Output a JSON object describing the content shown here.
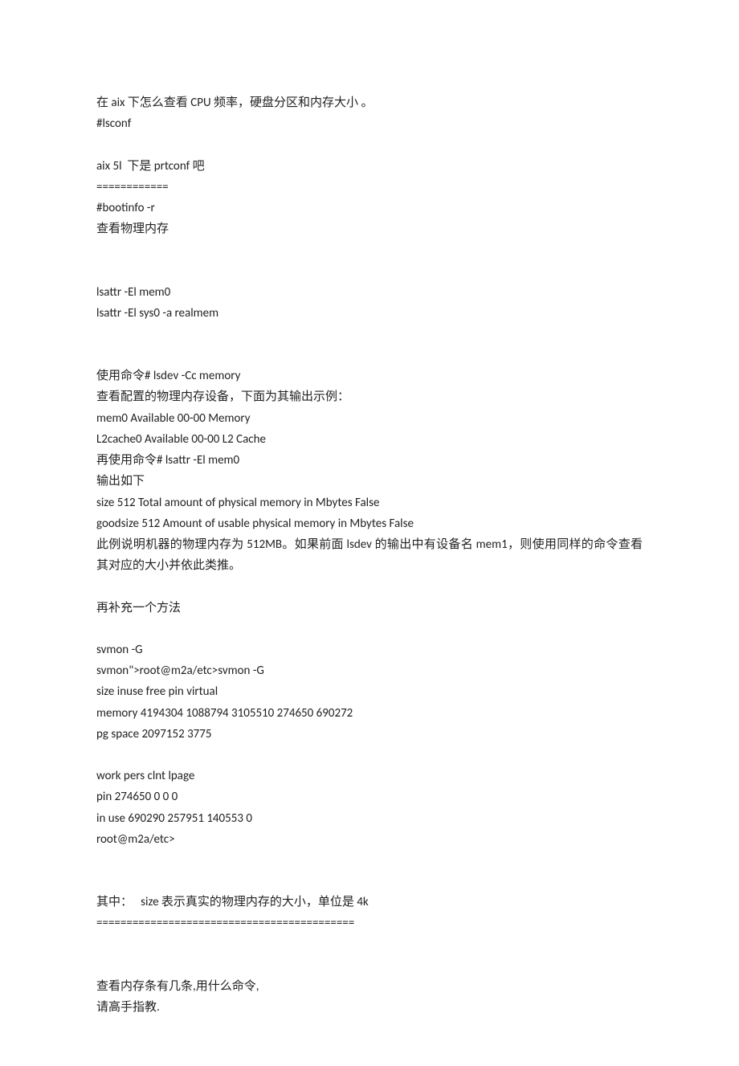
{
  "lines": [
    "在 aix 下怎么查看 CPU 频率，硬盘分区和内存大小 。",
    "#lsconf",
    "",
    "aix 5l  下是 prtconf 吧",
    "============",
    "#bootinfo -r",
    "查看物理内存",
    "",
    "",
    "lsattr -El mem0",
    "lsattr -El sys0 -a realmem",
    "",
    "",
    "使用命令# lsdev -Cc memory",
    "查看配置的物理内存设备，下面为其输出示例：",
    "mem0 Available 00-00 Memory",
    "L2cache0 Available 00-00 L2 Cache",
    "再使用命令# lsattr -El mem0",
    "输出如下",
    "size 512 Total amount of physical memory in Mbytes False",
    "goodsize 512 Amount of usable physical memory in Mbytes False",
    "此例说明机器的物理内存为 512MB。如果前面 lsdev 的输出中有设备名 mem1，则使用同样的命令查看其对应的大小并依此类推。",
    "",
    "再补充一个方法",
    "",
    "svmon -G",
    "svmon\">root@m2a/etc>svmon -G",
    "size inuse free pin virtual",
    "memory 4194304 1088794 3105510 274650 690272",
    "pg space 2097152 3775",
    "",
    "work pers clnt lpage",
    "pin 274650 0 0 0",
    "in use 690290 257951 140553 0",
    "root@m2a/etc>",
    "",
    "",
    "其中：   size 表示真实的物理内存的大小，单位是 4k",
    "===========================================",
    "",
    "",
    "查看内存条有几条,用什么命令,",
    "请高手指教."
  ]
}
